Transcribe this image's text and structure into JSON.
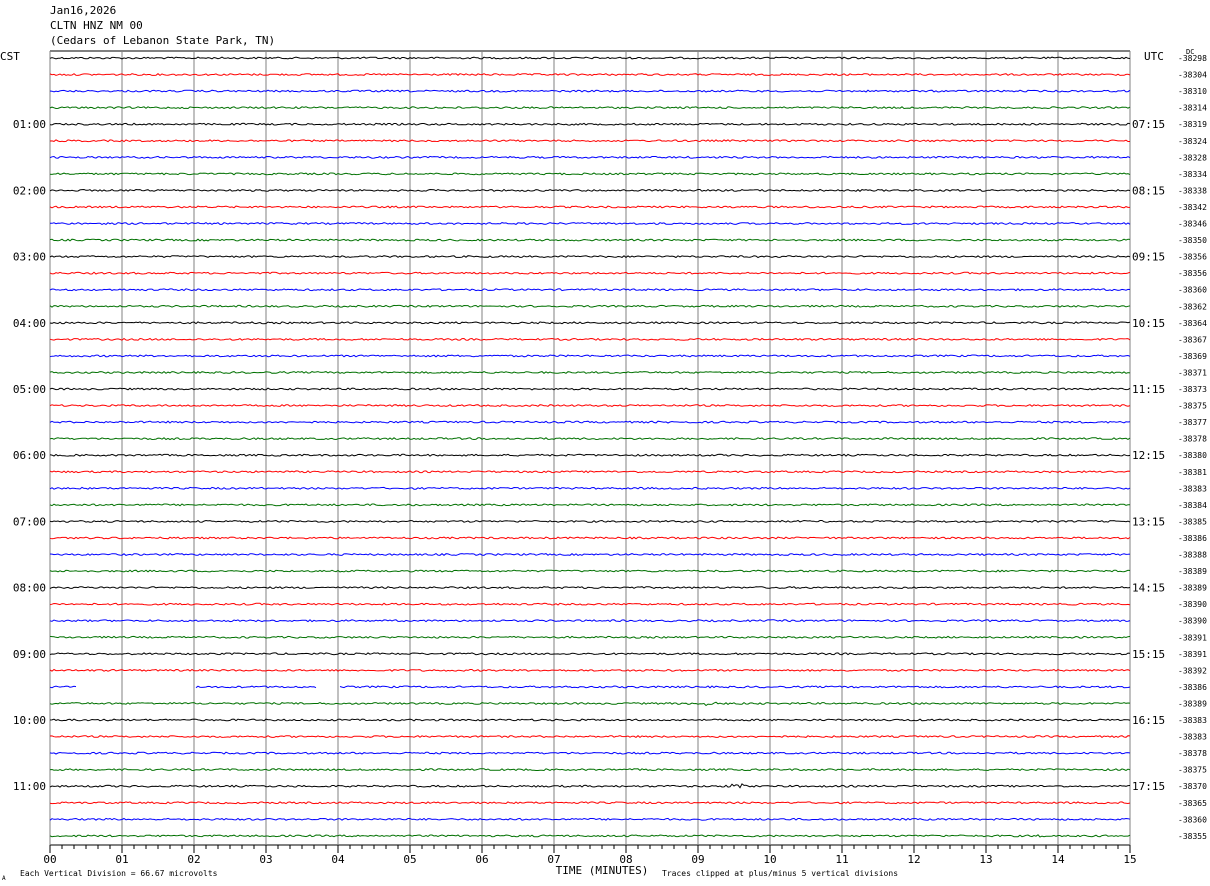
{
  "header": {
    "date": "Jan16,2026",
    "station": "CLTN HNZ NM 00",
    "location": "(Cedars of Lebanon State Park, TN)"
  },
  "left_timezone": "CST",
  "right_timezone": "UTC",
  "right_corner_label": "DC",
  "footer": {
    "scale_note": "Each Vertical Division =   66.67 microvolts",
    "xlabel": "TIME (MINUTES)",
    "clip_note": "Traces clipped at plus/minus 5 vertical divisions",
    "corner_mark": "A"
  },
  "colors": {
    "cycle": [
      "#000000",
      "#ff0000",
      "#0000ff",
      "#007000"
    ],
    "grid": "#808080"
  },
  "chart_data": {
    "type": "line",
    "title": "Jan16,2026 CLTN HNZ NM 00",
    "xlabel": "TIME (MINUTES)",
    "x_ticks": [
      "00",
      "01",
      "02",
      "03",
      "04",
      "05",
      "06",
      "07",
      "08",
      "09",
      "10",
      "11",
      "12",
      "13",
      "14",
      "15"
    ],
    "xlim": [
      0,
      15
    ],
    "left_hour_labels": [
      "01:00",
      "02:00",
      "03:00",
      "04:00",
      "05:00",
      "06:00",
      "07:00",
      "08:00",
      "09:00",
      "10:00",
      "11:00"
    ],
    "right_hour_labels": [
      "07:15",
      "08:15",
      "09:15",
      "10:15",
      "11:15",
      "12:15",
      "13:15",
      "14:15",
      "15:15",
      "16:15",
      "17:15"
    ],
    "dc_values": [
      "-38298",
      "-38304",
      "-38310",
      "-38314",
      "-38319",
      "-38324",
      "-38328",
      "-38334",
      "-38338",
      "-38342",
      "-38346",
      "-38350",
      "-38356",
      "-38356",
      "-38360",
      "-38362",
      "-38364",
      "-38367",
      "-38369",
      "-38371",
      "-38373",
      "-38375",
      "-38377",
      "-38378",
      "-38380",
      "-38381",
      "-38383",
      "-38384",
      "-38385",
      "-38386",
      "-38388",
      "-38389",
      "-38389",
      "-38390",
      "-38390",
      "-38391",
      "-38391",
      "-38392",
      "-38386",
      "-38389",
      "-38383",
      "-38383",
      "-38378",
      "-38375",
      "-38370",
      "-38365",
      "-38360",
      "-38355"
    ],
    "gaps": [
      {
        "row": 38,
        "x_start_min": 0.38,
        "x_end_min": 2.0
      },
      {
        "row": 38,
        "x_start_min": 3.7,
        "x_end_min": 4.0
      }
    ],
    "events": [
      {
        "row": 39,
        "minute": 9.1,
        "amplitude_div": 1.2
      },
      {
        "row": 44,
        "minute": 9.4,
        "amplitude_div": 2.0
      },
      {
        "row": 47,
        "minute": 13.7,
        "amplitude_div": 0.4
      }
    ]
  }
}
